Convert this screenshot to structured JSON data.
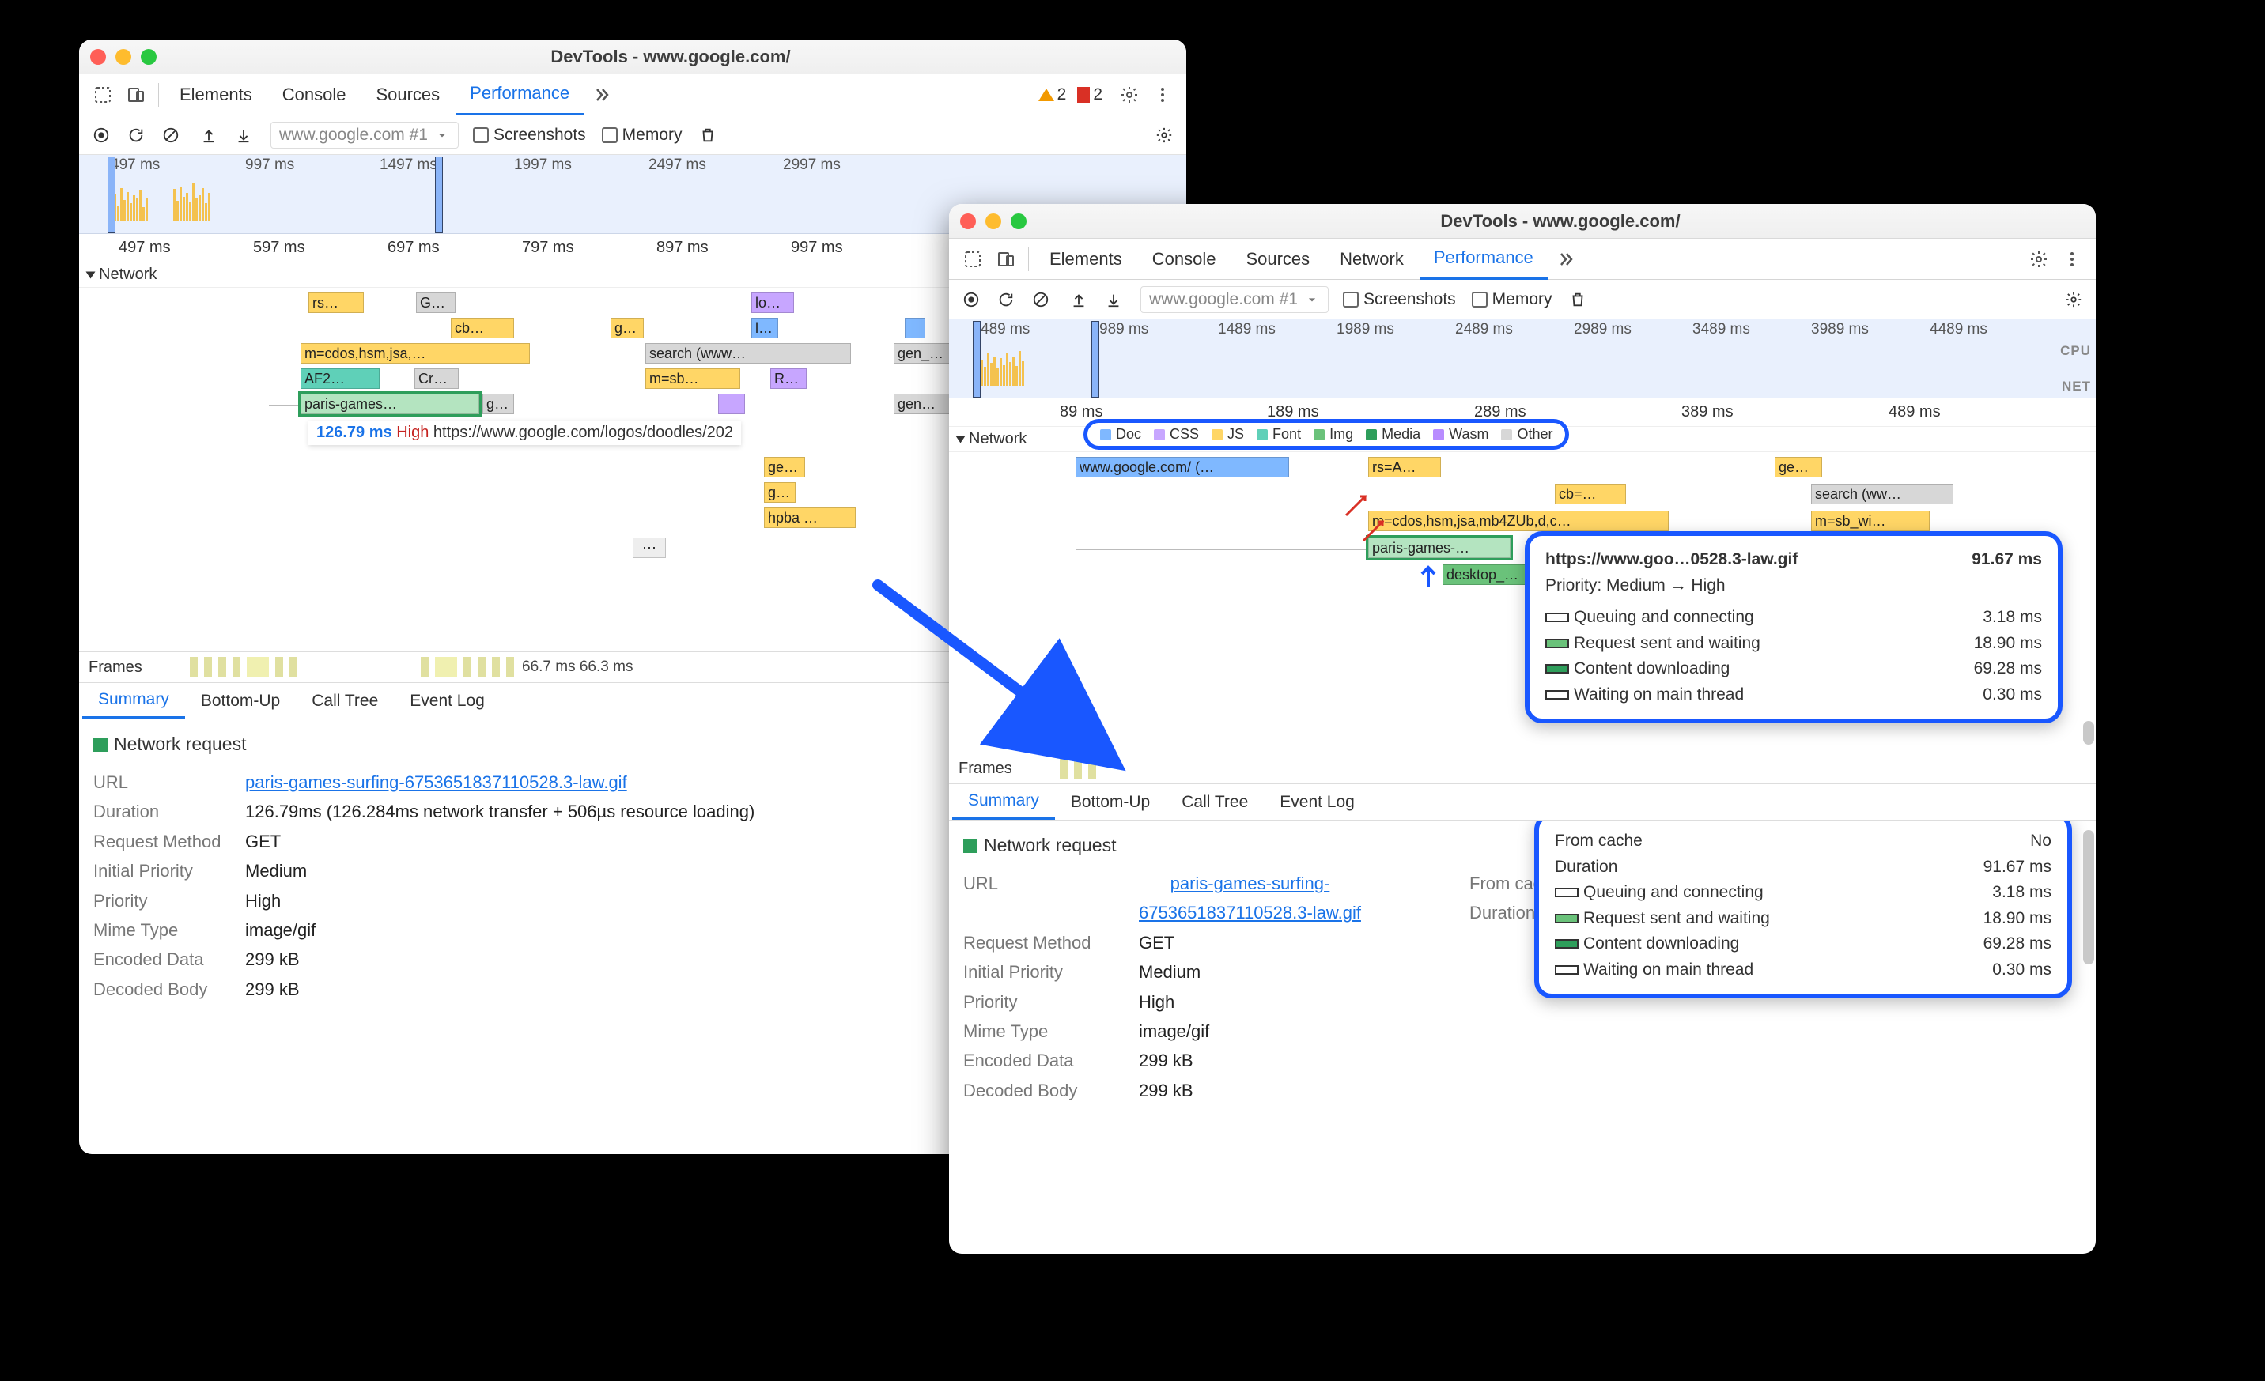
{
  "window_left": {
    "title": "DevTools - www.google.com/",
    "tabs": {
      "elements": "Elements",
      "console": "Console",
      "sources": "Sources",
      "performance": "Performance"
    },
    "warnings": "2",
    "issues": "2",
    "url_combo": "www.google.com #1",
    "chk_screenshots": "Screenshots",
    "chk_memory": "Memory",
    "mini_ticks": [
      "497 ms",
      "997 ms",
      "1497 ms",
      "1997 ms",
      "2497 ms",
      "2997 ms"
    ],
    "ruler": [
      "497 ms",
      "597 ms",
      "697 ms",
      "797 ms",
      "897 ms",
      "997 ms"
    ],
    "network_label": "Network",
    "blocks": {
      "rs": "rs…",
      "g1": "G…",
      "lo": "lo…",
      "cb": "cb…",
      "gg": "g…",
      "ll": "l…",
      "mcd": "m=cdos,hsm,jsa,…",
      "search": "search (www…",
      "gen1": "gen_…",
      "af2": "AF2…",
      "cr": "Cr…",
      "msb": "m=sb…",
      "r": "R…",
      "paris": "paris-games…",
      "gg2": "g…",
      "gen2": "gen…",
      "ge": "ge…",
      "g4": "g…",
      "hpba": "hpba …",
      "dots": "⋯"
    },
    "tooltip": {
      "dur": "126.79 ms",
      "pri": "High",
      "url": "https://www.google.com/logos/doodles/202"
    },
    "frames_label": "Frames",
    "frames_times": "66.7 ms 66.3 ms",
    "btabs": {
      "summary": "Summary",
      "bottomup": "Bottom-Up",
      "calltree": "Call Tree",
      "eventlog": "Event Log"
    },
    "detail_heading": "Network request",
    "kv": {
      "url_k": "URL",
      "url_v": "paris-games-surfing-6753651837110528.3-law.gif",
      "dur_k": "Duration",
      "dur_v": "126.79ms (126.284ms network transfer + 506µs resource loading)",
      "rm_k": "Request Method",
      "rm_v": "GET",
      "ip_k": "Initial Priority",
      "ip_v": "Medium",
      "p_k": "Priority",
      "p_v": "High",
      "mt_k": "Mime Type",
      "mt_v": "image/gif",
      "ed_k": "Encoded Data",
      "ed_v": "299 kB",
      "db_k": "Decoded Body",
      "db_v": "299 kB"
    }
  },
  "window_right": {
    "title": "DevTools - www.google.com/",
    "tabs": {
      "elements": "Elements",
      "console": "Console",
      "sources": "Sources",
      "network": "Network",
      "performance": "Performance"
    },
    "url_combo": "www.google.com #1",
    "chk_screenshots": "Screenshots",
    "chk_memory": "Memory",
    "mini_ticks": [
      "489 ms",
      "989 ms",
      "1489 ms",
      "1989 ms",
      "2489 ms",
      "2989 ms",
      "3489 ms",
      "3989 ms",
      "4489 ms"
    ],
    "cpu_label": "CPU",
    "net_label": "NET",
    "ruler": [
      "89 ms",
      "189 ms",
      "289 ms",
      "389 ms",
      "489 ms"
    ],
    "network_label": "Network",
    "legend": {
      "doc": "Doc",
      "css": "CSS",
      "js": "JS",
      "font": "Font",
      "img": "Img",
      "media": "Media",
      "wasm": "Wasm",
      "other": "Other"
    },
    "blocks": {
      "goog": "www.google.com/ (…",
      "rsA": "rs=A…",
      "ge": "ge…",
      "cb": "cb=…",
      "search": "search (ww…",
      "mcd": "m=cdos,hsm,jsa,mb4ZUb,d,c…",
      "msb": "m=sb_wi…",
      "paris": "paris-games-…",
      "desktop": "desktop_…"
    },
    "big_tooltip": {
      "url": "https://www.goo…0528.3-law.gif",
      "total": "91.67 ms",
      "priority_label": "Priority:",
      "priority_from": "Medium",
      "priority_to": "High",
      "rows": [
        {
          "label": "Queuing and connecting",
          "val": "3.18 ms"
        },
        {
          "label": "Request sent and waiting",
          "val": "18.90 ms"
        },
        {
          "label": "Content downloading",
          "val": "69.28 ms"
        },
        {
          "label": "Waiting on main thread",
          "val": "0.30 ms"
        }
      ]
    },
    "frames_label": "Frames",
    "btabs": {
      "summary": "Summary",
      "bottomup": "Bottom-Up",
      "calltree": "Call Tree",
      "eventlog": "Event Log"
    },
    "detail_heading": "Network request",
    "kv_left": {
      "url_k": "URL",
      "url_v1": "paris-games-surfing-",
      "url_v2": "6753651837110528.3-law.gif",
      "rm_k": "Request Method",
      "rm_v": "GET",
      "ip_k": "Initial Priority",
      "ip_v": "Medium",
      "p_k": "Priority",
      "p_v": "High",
      "mt_k": "Mime Type",
      "mt_v": "image/gif",
      "ed_k": "Encoded Data",
      "ed_v": "299 kB",
      "db_k": "Decoded Body",
      "db_v": "299 kB"
    },
    "kv_right": {
      "fc_k": "From cache",
      "fc_v": "No",
      "dur_k": "Duration",
      "dur_v": "91.67 ms",
      "rows": [
        {
          "label": "Queuing and connecting",
          "val": "3.18 ms"
        },
        {
          "label": "Request sent and waiting",
          "val": "18.90 ms"
        },
        {
          "label": "Content downloading",
          "val": "69.28 ms"
        },
        {
          "label": "Waiting on main thread",
          "val": "0.30 ms"
        }
      ]
    }
  },
  "colors": {
    "doc": "#7fb8ff",
    "css": "#c7a6ff",
    "js": "#ffd666",
    "font": "#5fd0b8",
    "img": "#6ac27a",
    "media": "#2e9e5b",
    "wasm": "#b88cff",
    "other": "#d7d7d7"
  }
}
